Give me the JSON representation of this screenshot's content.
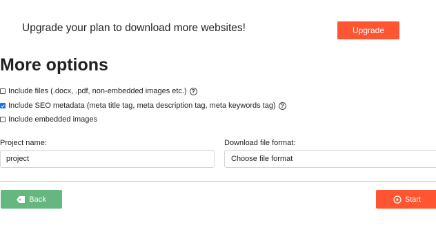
{
  "upgrade": {
    "message": "Upgrade your plan to download more websites!",
    "button_label": "Upgrade"
  },
  "options": {
    "title": "More options",
    "items": [
      {
        "label": "Include files (.docx, .pdf, non-embedded images etc.)",
        "checked": false,
        "help": true
      },
      {
        "label": "Include SEO metadata (meta title tag, meta description tag, meta keywords tag)",
        "checked": true,
        "help": true
      },
      {
        "label": "Include embedded images",
        "checked": false,
        "help": false
      }
    ]
  },
  "form": {
    "project_label": "Project name:",
    "project_value": "project",
    "format_label": "Download file format:",
    "format_value": "Choose file format"
  },
  "actions": {
    "back_label": "Back",
    "start_label": "Start"
  },
  "icons": {
    "help": "question-circle-icon",
    "back": "tag-back-icon",
    "start": "play-circle-icon"
  },
  "colors": {
    "accent": "#ff5533",
    "back": "#64b77e",
    "checkbox": "#1a73e8"
  }
}
